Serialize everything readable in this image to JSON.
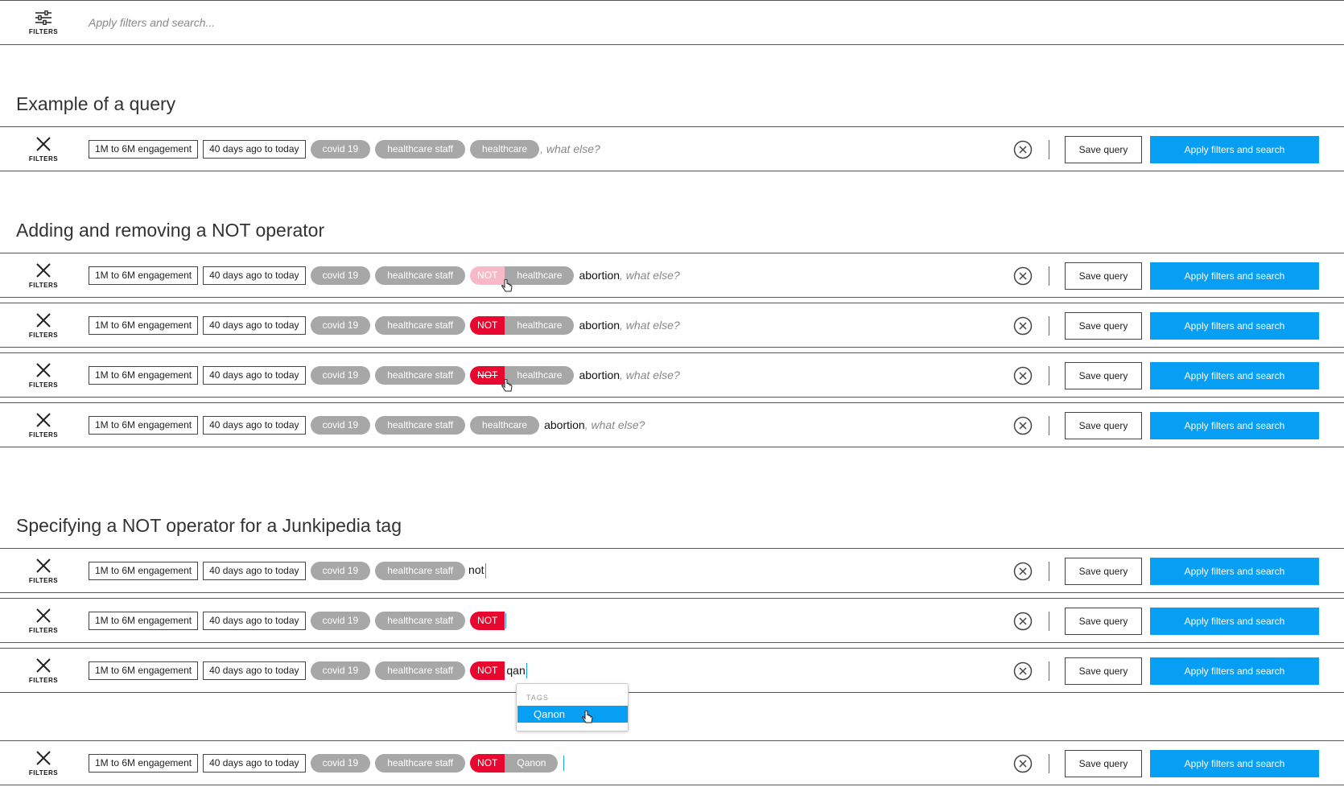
{
  "search": {
    "filters_label": "FILTERS",
    "placeholder": "Apply filters and search..."
  },
  "sections": [
    {
      "title": "Example of a query"
    },
    {
      "title": "Adding and removing a NOT operator"
    },
    {
      "title": "Specifying a NOT operator for a Junkipedia tag"
    }
  ],
  "common": {
    "filters_label": "FILTERS",
    "engagement": "1M to 6M engagement",
    "date_range": "40 days ago to today",
    "tag_covid": "covid 19",
    "tag_staff": "healthcare staff",
    "tag_healthcare": "healthcare",
    "not_label": "NOT",
    "typed_abortion": "abortion",
    "what_else": ", what else?",
    "save_label": "Save query",
    "apply_label": "Apply filters and search"
  },
  "typing": {
    "not_typed": "not",
    "qan_typed": "qan",
    "tag_qanon": "Qanon"
  },
  "dropdown": {
    "header": "TAGS",
    "option": "Qanon"
  },
  "colors": {
    "accent": "#069ff3",
    "not_red": "#e8082f",
    "not_hover": "#f7b9c8",
    "tag_gray": "#a7a7a7"
  }
}
